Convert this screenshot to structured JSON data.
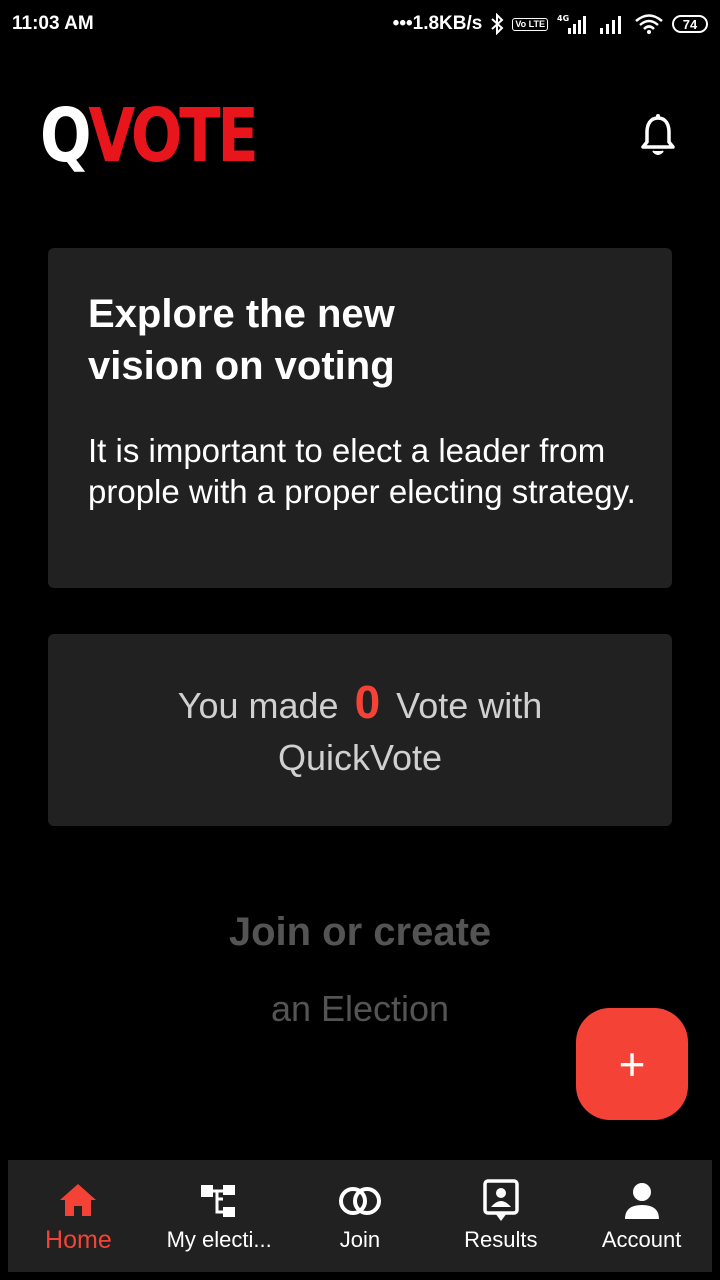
{
  "status_bar": {
    "time": "11:03 AM",
    "net_speed": "•••1.8KB/s",
    "lte_badge": "Vo LTE",
    "signal_label": "4G",
    "battery": "74"
  },
  "header": {
    "logo_q": "Q",
    "logo_rest": "VOTE",
    "icons": [
      "bell-icon"
    ]
  },
  "explore_card": {
    "title": "Explore the new vision on voting",
    "body": "It is important to elect a leader from prople with a proper electing strategy."
  },
  "votes_card": {
    "prefix": "You made",
    "count": "0",
    "suffix": "Vote with QuickVote"
  },
  "join_section": {
    "title": "Join or create",
    "subtitle": "an Election"
  },
  "fab": {
    "label": "+"
  },
  "bottom_nav": {
    "items": [
      {
        "label": "Home",
        "icon": "home-icon",
        "active": true
      },
      {
        "label": "My electi...",
        "icon": "elections-icon",
        "active": false
      },
      {
        "label": "Join",
        "icon": "join-icon",
        "active": false
      },
      {
        "label": "Results",
        "icon": "results-icon",
        "active": false
      },
      {
        "label": "Account",
        "icon": "account-icon",
        "active": false
      }
    ]
  },
  "colors": {
    "background": "#000000",
    "card": "#212121",
    "accent": "#f44336",
    "logo_red": "#e8161c",
    "muted_text": "#545454"
  }
}
